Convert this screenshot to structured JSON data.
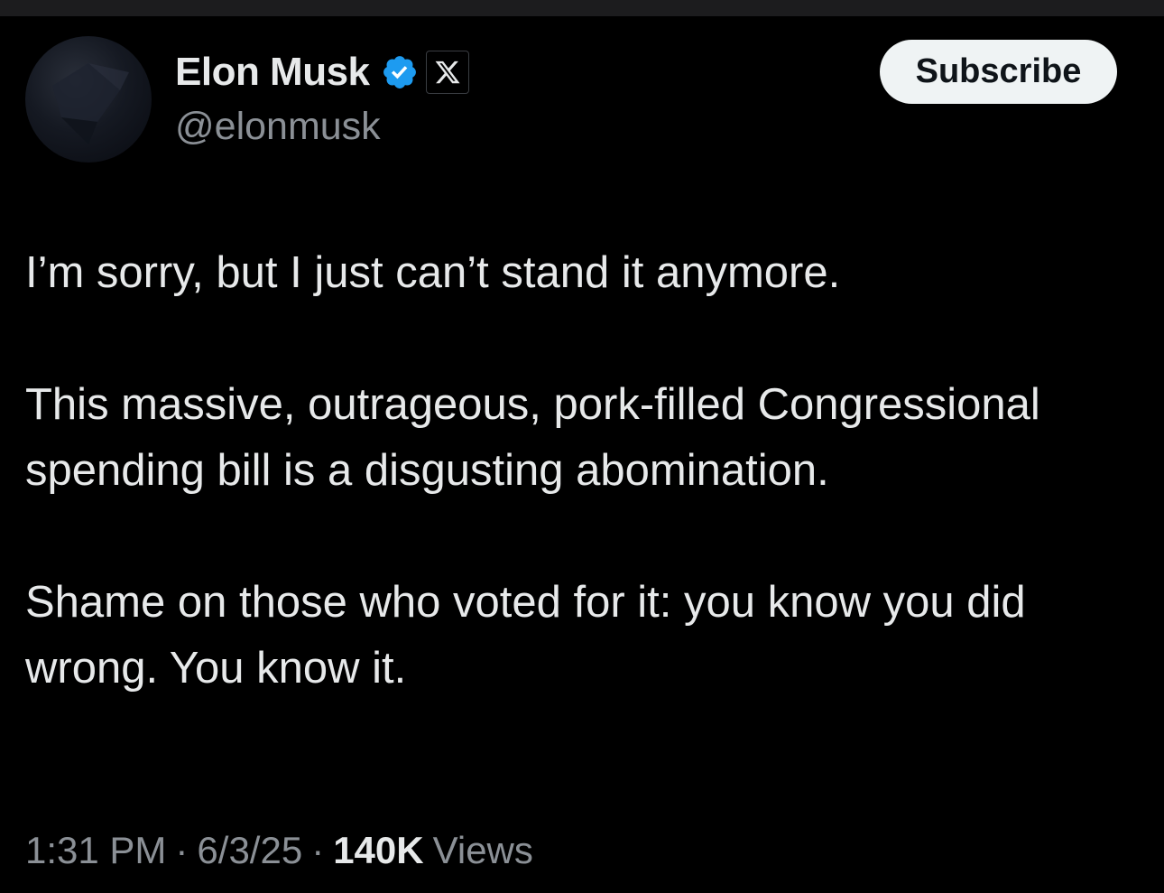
{
  "author": {
    "display_name": "Elon Musk",
    "handle": "@elonmusk",
    "verified_icon": "verified-badge-icon",
    "affiliation_icon": "x-logo-icon"
  },
  "actions": {
    "subscribe_label": "Subscribe"
  },
  "tweet": {
    "paragraphs": [
      "I’m sorry, but I just can’t stand it anymore.",
      "This massive, outrageous, pork-filled Congressional spending bill is a disgusting abomination.",
      "Shame on those who voted for it: you know you did wrong. You know it."
    ]
  },
  "meta": {
    "time": "1:31 PM",
    "separator": "·",
    "date": "6/3/25",
    "views_count": "140K",
    "views_label": "Views"
  },
  "colors": {
    "background": "#000000",
    "text": "#e7e9ea",
    "secondary_text": "#8b9096",
    "verified_blue": "#1d9bf0",
    "button_bg": "#eff3f4"
  }
}
